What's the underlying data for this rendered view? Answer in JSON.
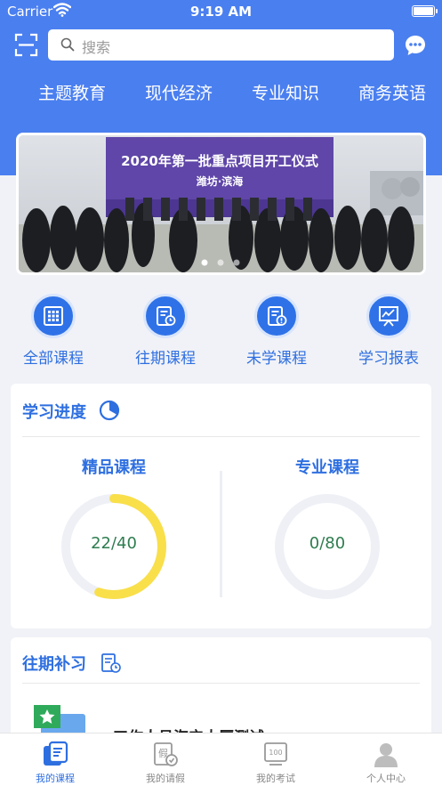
{
  "status_bar": {
    "carrier": "Carrier",
    "time": "9:19 AM"
  },
  "search": {
    "placeholder": "搜索"
  },
  "nav_tabs": [
    "主题教育",
    "现代经济",
    "专业知识",
    "商务英语"
  ],
  "banner": {
    "headline": "2020年第一批重点项目开工仪式",
    "subline": "潍坊·滨海",
    "page_count": 3,
    "active_page": 1
  },
  "quick_actions": [
    {
      "label": "全部课程",
      "icon": "grid-book-icon"
    },
    {
      "label": "往期课程",
      "icon": "history-document-icon"
    },
    {
      "label": "未学课程",
      "icon": "unread-document-icon"
    },
    {
      "label": "学习报表",
      "icon": "report-chart-icon"
    }
  ],
  "progress": {
    "title": "学习进度",
    "items": [
      {
        "label": "精品课程",
        "value": "22/40",
        "done": 22,
        "total": 40,
        "color": "#f9df4a"
      },
      {
        "label": "专业课程",
        "value": "0/80",
        "done": 0,
        "total": 80,
        "color": "#f9df4a"
      }
    ]
  },
  "history": {
    "title": "往期补习",
    "first_item_title": "工作人员海宁大厦测试"
  },
  "tabbar": [
    {
      "label": "我的课程",
      "icon": "my-course-icon",
      "active": true
    },
    {
      "label": "我的请假",
      "icon": "leave-request-icon",
      "active": false
    },
    {
      "label": "我的考试",
      "icon": "exam-icon",
      "active": false
    },
    {
      "label": "个人中心",
      "icon": "profile-icon",
      "active": false
    }
  ],
  "colors": {
    "primary": "#4a7ff0",
    "accent": "#2e6fe0",
    "ring_fill": "#f9df4a",
    "ring_track": "#eef0f6",
    "value_text": "#2e7d4f"
  }
}
